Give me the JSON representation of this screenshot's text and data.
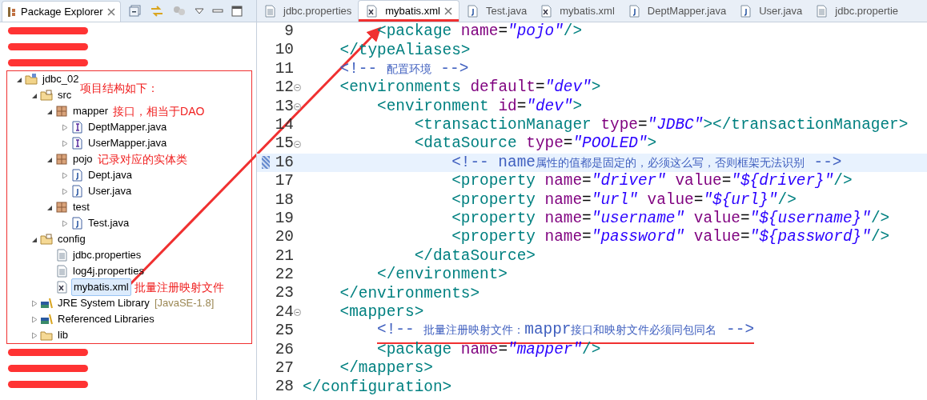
{
  "explorer": {
    "title": "Package Explorer",
    "items": [
      {
        "kind": "redacted"
      },
      {
        "kind": "redacted"
      },
      {
        "kind": "redacted"
      },
      {
        "kind": "project",
        "label": "jdbc_02",
        "expanded": true,
        "outlined": true,
        "note": "项目结构如下：",
        "children": [
          {
            "kind": "source-folder",
            "label": "src",
            "expanded": true,
            "children": [
              {
                "kind": "package",
                "label": "mapper",
                "expanded": true,
                "note": "接口，相当于DAO",
                "children": [
                  {
                    "kind": "interface",
                    "label": "DeptMapper.java",
                    "expanded": false
                  },
                  {
                    "kind": "interface",
                    "label": "UserMapper.java",
                    "expanded": false
                  }
                ]
              },
              {
                "kind": "package",
                "label": "pojo",
                "expanded": true,
                "note": "记录对应的实体类",
                "children": [
                  {
                    "kind": "class",
                    "label": "Dept.java",
                    "expanded": false
                  },
                  {
                    "kind": "class",
                    "label": "User.java",
                    "expanded": false
                  }
                ]
              },
              {
                "kind": "package",
                "label": "test",
                "expanded": true,
                "children": [
                  {
                    "kind": "class",
                    "label": "Test.java",
                    "expanded": false
                  }
                ]
              }
            ]
          },
          {
            "kind": "source-folder",
            "label": "config",
            "expanded": true,
            "children": [
              {
                "kind": "properties",
                "label": "jdbc.properties"
              },
              {
                "kind": "properties",
                "label": "log4j.properties"
              },
              {
                "kind": "xml",
                "label": "mybatis.xml",
                "selected": true,
                "note": "批量注册映射文件"
              }
            ]
          },
          {
            "kind": "library",
            "label": "JRE System Library",
            "decoration": "[JavaSE-1.8]",
            "expanded": false
          },
          {
            "kind": "library",
            "label": "Referenced Libraries",
            "expanded": false
          },
          {
            "kind": "folder",
            "label": "lib",
            "expanded": false
          }
        ]
      },
      {
        "kind": "redacted"
      },
      {
        "kind": "redacted"
      },
      {
        "kind": "redacted"
      }
    ]
  },
  "editor": {
    "tabs": [
      {
        "kind": "properties",
        "label": "jdbc.properties",
        "selected": false
      },
      {
        "kind": "xml",
        "label": "mybatis.xml",
        "selected": true,
        "underlined": true
      },
      {
        "kind": "java",
        "label": "Test.java",
        "selected": false
      },
      {
        "kind": "xml",
        "label": "mybatis.xml",
        "selected": false
      },
      {
        "kind": "java",
        "label": "DeptMapper.java",
        "selected": false
      },
      {
        "kind": "java",
        "label": "User.java",
        "selected": false
      },
      {
        "kind": "properties",
        "label": "jdbc.propertie",
        "selected": false
      }
    ],
    "lines": [
      {
        "number": "9",
        "segments": [
          {
            "kind": "tag",
            "text": "        <package "
          },
          {
            "kind": "attr",
            "text": "name"
          },
          {
            "kind": "punct",
            "text": "="
          },
          {
            "kind": "string",
            "text": "\"pojo\""
          },
          {
            "kind": "tag",
            "text": "/>"
          }
        ]
      },
      {
        "number": "10",
        "segments": [
          {
            "kind": "tag",
            "text": "    </typeAliases>"
          }
        ]
      },
      {
        "number": "11",
        "segments": [
          {
            "kind": "comment",
            "text": "    <!-- 配置环境 -->"
          }
        ]
      },
      {
        "number": "12",
        "fold": true,
        "segments": [
          {
            "kind": "tag",
            "text": "    <environments "
          },
          {
            "kind": "attr",
            "text": "default"
          },
          {
            "kind": "punct",
            "text": "="
          },
          {
            "kind": "string",
            "text": "\"dev\""
          },
          {
            "kind": "tag",
            "text": ">"
          }
        ]
      },
      {
        "number": "13",
        "fold": true,
        "segments": [
          {
            "kind": "tag",
            "text": "        <environment "
          },
          {
            "kind": "attr",
            "text": "id"
          },
          {
            "kind": "punct",
            "text": "="
          },
          {
            "kind": "string",
            "text": "\"dev\""
          },
          {
            "kind": "tag",
            "text": ">"
          }
        ]
      },
      {
        "number": "14",
        "segments": [
          {
            "kind": "tag",
            "text": "            <transactionManager "
          },
          {
            "kind": "attr",
            "text": "type"
          },
          {
            "kind": "punct",
            "text": "="
          },
          {
            "kind": "string",
            "text": "\"JDBC\""
          },
          {
            "kind": "tag",
            "text": "></transactionManager>"
          }
        ]
      },
      {
        "number": "15",
        "fold": true,
        "segments": [
          {
            "kind": "tag",
            "text": "            <dataSource "
          },
          {
            "kind": "attr",
            "text": "type"
          },
          {
            "kind": "punct",
            "text": "="
          },
          {
            "kind": "string",
            "text": "\"POOLED\""
          },
          {
            "kind": "tag",
            "text": ">"
          }
        ]
      },
      {
        "number": "16",
        "current": true,
        "segments": [
          {
            "kind": "comment",
            "text": "                <!-- name属性的值都是固定的，必须这么写，否则框架无法识别 -->"
          }
        ]
      },
      {
        "number": "17",
        "segments": [
          {
            "kind": "tag",
            "text": "                <property "
          },
          {
            "kind": "attr",
            "text": "name"
          },
          {
            "kind": "punct",
            "text": "="
          },
          {
            "kind": "string",
            "text": "\"driver\""
          },
          {
            "kind": "attr",
            "text": " value"
          },
          {
            "kind": "punct",
            "text": "="
          },
          {
            "kind": "string",
            "text": "\"${driver}\""
          },
          {
            "kind": "tag",
            "text": "/>"
          }
        ]
      },
      {
        "number": "18",
        "segments": [
          {
            "kind": "tag",
            "text": "                <property "
          },
          {
            "kind": "attr",
            "text": "name"
          },
          {
            "kind": "punct",
            "text": "="
          },
          {
            "kind": "string",
            "text": "\"url\""
          },
          {
            "kind": "attr",
            "text": " value"
          },
          {
            "kind": "punct",
            "text": "="
          },
          {
            "kind": "string",
            "text": "\"${url}\""
          },
          {
            "kind": "tag",
            "text": "/>"
          }
        ]
      },
      {
        "number": "19",
        "segments": [
          {
            "kind": "tag",
            "text": "                <property "
          },
          {
            "kind": "attr",
            "text": "name"
          },
          {
            "kind": "punct",
            "text": "="
          },
          {
            "kind": "string",
            "text": "\"username\""
          },
          {
            "kind": "attr",
            "text": " value"
          },
          {
            "kind": "punct",
            "text": "="
          },
          {
            "kind": "string",
            "text": "\"${username}\""
          },
          {
            "kind": "tag",
            "text": "/>"
          }
        ]
      },
      {
        "number": "20",
        "segments": [
          {
            "kind": "tag",
            "text": "                <property "
          },
          {
            "kind": "attr",
            "text": "name"
          },
          {
            "kind": "punct",
            "text": "="
          },
          {
            "kind": "string",
            "text": "\"password\""
          },
          {
            "kind": "attr",
            "text": " value"
          },
          {
            "kind": "punct",
            "text": "="
          },
          {
            "kind": "string",
            "text": "\"${password}\""
          },
          {
            "kind": "tag",
            "text": "/>"
          }
        ]
      },
      {
        "number": "21",
        "segments": [
          {
            "kind": "tag",
            "text": "            </dataSource>"
          }
        ]
      },
      {
        "number": "22",
        "segments": [
          {
            "kind": "tag",
            "text": "        </environment>"
          }
        ]
      },
      {
        "number": "23",
        "segments": [
          {
            "kind": "tag",
            "text": "    </environments>"
          }
        ]
      },
      {
        "number": "24",
        "fold": true,
        "segments": [
          {
            "kind": "tag",
            "text": "    <mappers>"
          }
        ]
      },
      {
        "number": "25",
        "underlined": true,
        "segments": [
          {
            "kind": "comment",
            "text": "        <!-- 批量注册映射文件：mappr接口和映射文件必须同包同名 -->"
          }
        ]
      },
      {
        "number": "26",
        "segments": [
          {
            "kind": "tag",
            "text": "        <package "
          },
          {
            "kind": "attr",
            "text": "name"
          },
          {
            "kind": "punct",
            "text": "="
          },
          {
            "kind": "string",
            "text": "\"mapper\""
          },
          {
            "kind": "tag",
            "text": "/>"
          }
        ]
      },
      {
        "number": "27",
        "segments": [
          {
            "kind": "tag",
            "text": "    </mappers>"
          }
        ]
      },
      {
        "number": "28",
        "segments": [
          {
            "kind": "tag",
            "text": "</configuration>"
          }
        ]
      }
    ]
  }
}
